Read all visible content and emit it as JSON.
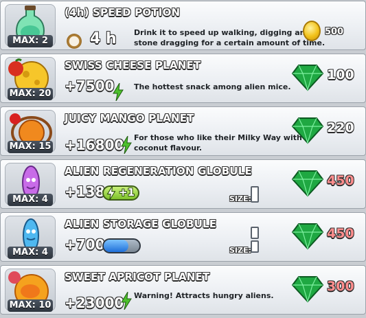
{
  "items": [
    {
      "title": "(4h) SPEED POTION",
      "max": "MAX: 2",
      "duration": "4 h",
      "description_lines": [
        "Drink it to speed up walking, digging and",
        "stone dragging for a certain amount of time."
      ],
      "price": "500",
      "currency": "coin",
      "icon": "speed-potion-icon"
    },
    {
      "title": "SWISS CHEESE PLANET",
      "max": "MAX: 20",
      "stat": "+7500",
      "description_lines": [
        "The hottest snack among alien mice."
      ],
      "price": "100",
      "currency": "gem",
      "affordable": true,
      "icon": "swiss-cheese-planet-icon"
    },
    {
      "title": "JUICY MANGO PLANET",
      "max": "MAX: 15",
      "stat": "+16800",
      "description_lines": [
        "For those who like their Milky Way with a",
        "coconut flavour."
      ],
      "price": "220",
      "currency": "gem",
      "affordable": true,
      "icon": "mango-planet-icon"
    },
    {
      "title": "ALIEN REGENERATION GLOBULE",
      "max": "MAX: 4",
      "stat": "+138",
      "regen": "+1",
      "size_label": "SIZE:",
      "price": "450",
      "currency": "gem",
      "affordable": false,
      "icon": "regeneration-globule-icon"
    },
    {
      "title": "ALIEN STORAGE GLOBULE",
      "max": "MAX: 4",
      "stat": "+700",
      "storage_fill": 0.7,
      "size_label": "SIZE:",
      "price": "450",
      "currency": "gem",
      "affordable": false,
      "icon": "storage-globule-icon"
    },
    {
      "title": "SWEET APRICOT PLANET",
      "max": "MAX: 10",
      "stat": "+23000",
      "description_lines": [
        "Warning! Attracts hungry aliens."
      ],
      "price": "300",
      "currency": "gem",
      "affordable": false,
      "icon": "apricot-planet-icon"
    }
  ],
  "colors": {
    "gem": "#1fa842",
    "price_unaffordable": "#ff8e8e",
    "energy": "#4cc02c",
    "coin": "#f2c21a"
  }
}
